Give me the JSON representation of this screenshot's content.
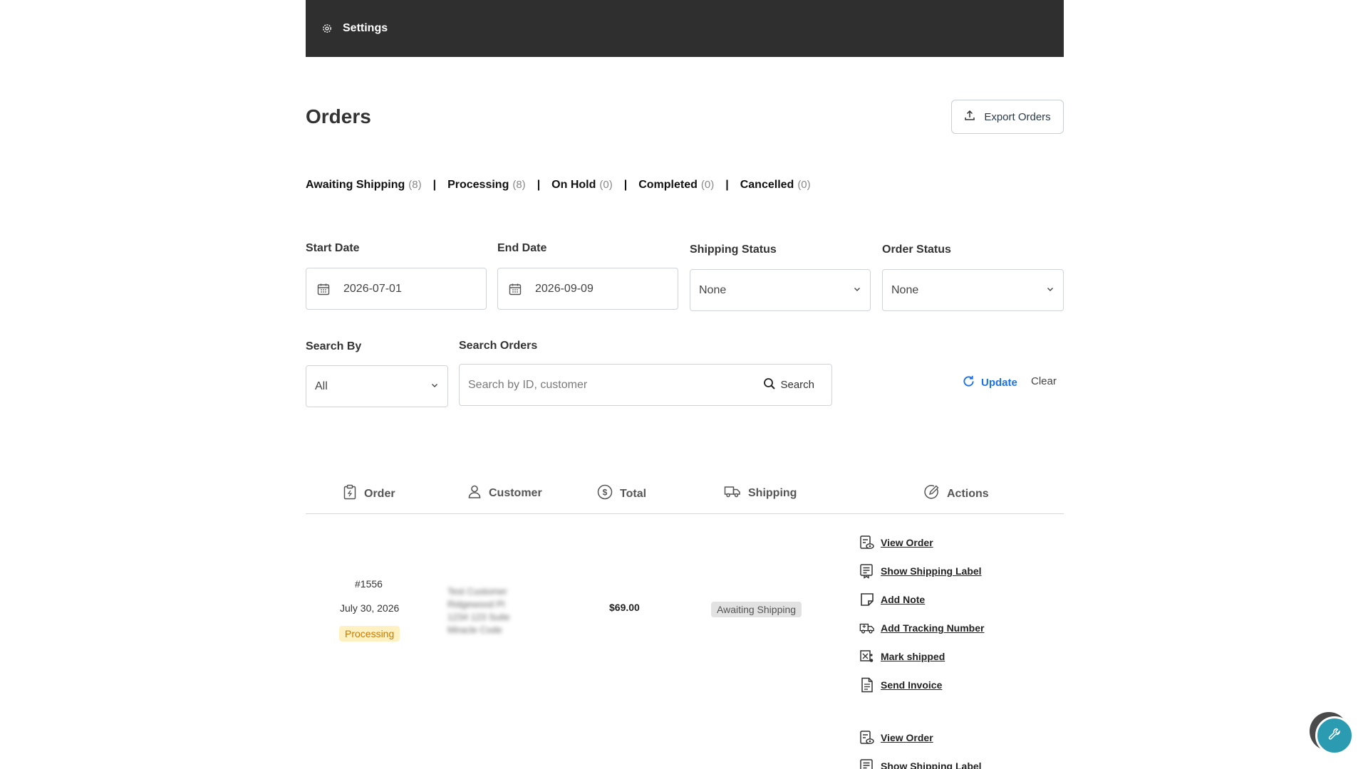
{
  "topbar": {
    "settings_label": "Settings"
  },
  "page": {
    "title": "Orders",
    "export_label": "Export Orders"
  },
  "status_tabs": [
    {
      "name": "Awaiting Shipping",
      "count": "(8)"
    },
    {
      "name": "Processing",
      "count": "(8)"
    },
    {
      "name": "On Hold",
      "count": "(0)"
    },
    {
      "name": "Completed",
      "count": "(0)"
    },
    {
      "name": "Cancelled",
      "count": "(0)"
    }
  ],
  "filters": {
    "start_date_label": "Start Date",
    "start_date_value": "2026-07-01",
    "end_date_label": "End Date",
    "end_date_value": "2026-09-09",
    "shipping_status_label": "Shipping Status",
    "shipping_status_value": "None",
    "order_status_label": "Order Status",
    "order_status_value": "None",
    "search_by_label": "Search By",
    "search_by_value": "All",
    "search_orders_label": "Search Orders",
    "search_placeholder": "Search by ID, customer",
    "search_button": "Search",
    "update_label": "Update",
    "clear_label": "Clear"
  },
  "table": {
    "headers": {
      "order": "Order",
      "customer": "Customer",
      "total": "Total",
      "shipping": "Shipping",
      "actions": "Actions"
    },
    "rows": [
      {
        "order_id": "#1556",
        "date": "July 30, 2026",
        "status": "Processing",
        "customer_lines": [
          "Test Customer",
          "Ridgewood Pl",
          "1234 123 Suite",
          "Miracle Code"
        ],
        "total": "$69.00",
        "shipping_status": "Awaiting Shipping",
        "actions": [
          "View Order",
          "Show Shipping Label",
          "Add Note",
          "Add Tracking Number",
          "Mark shipped",
          "Send Invoice"
        ]
      },
      {
        "actions": [
          "View Order",
          "Show Shipping Label"
        ]
      }
    ]
  },
  "colors": {
    "topbar": "#2f2f2f",
    "accent": "#1a73e8",
    "processing_bg": "#fff1c2",
    "processing_text": "#c97a00",
    "fab": "#2a9bb0"
  },
  "icons": {
    "settings": "gear-icon",
    "export": "upload-icon",
    "calendar": "calendar-icon",
    "chevron": "chevron-down-icon",
    "search": "search-icon",
    "update": "refresh-icon",
    "fab": "wrench-icon"
  }
}
